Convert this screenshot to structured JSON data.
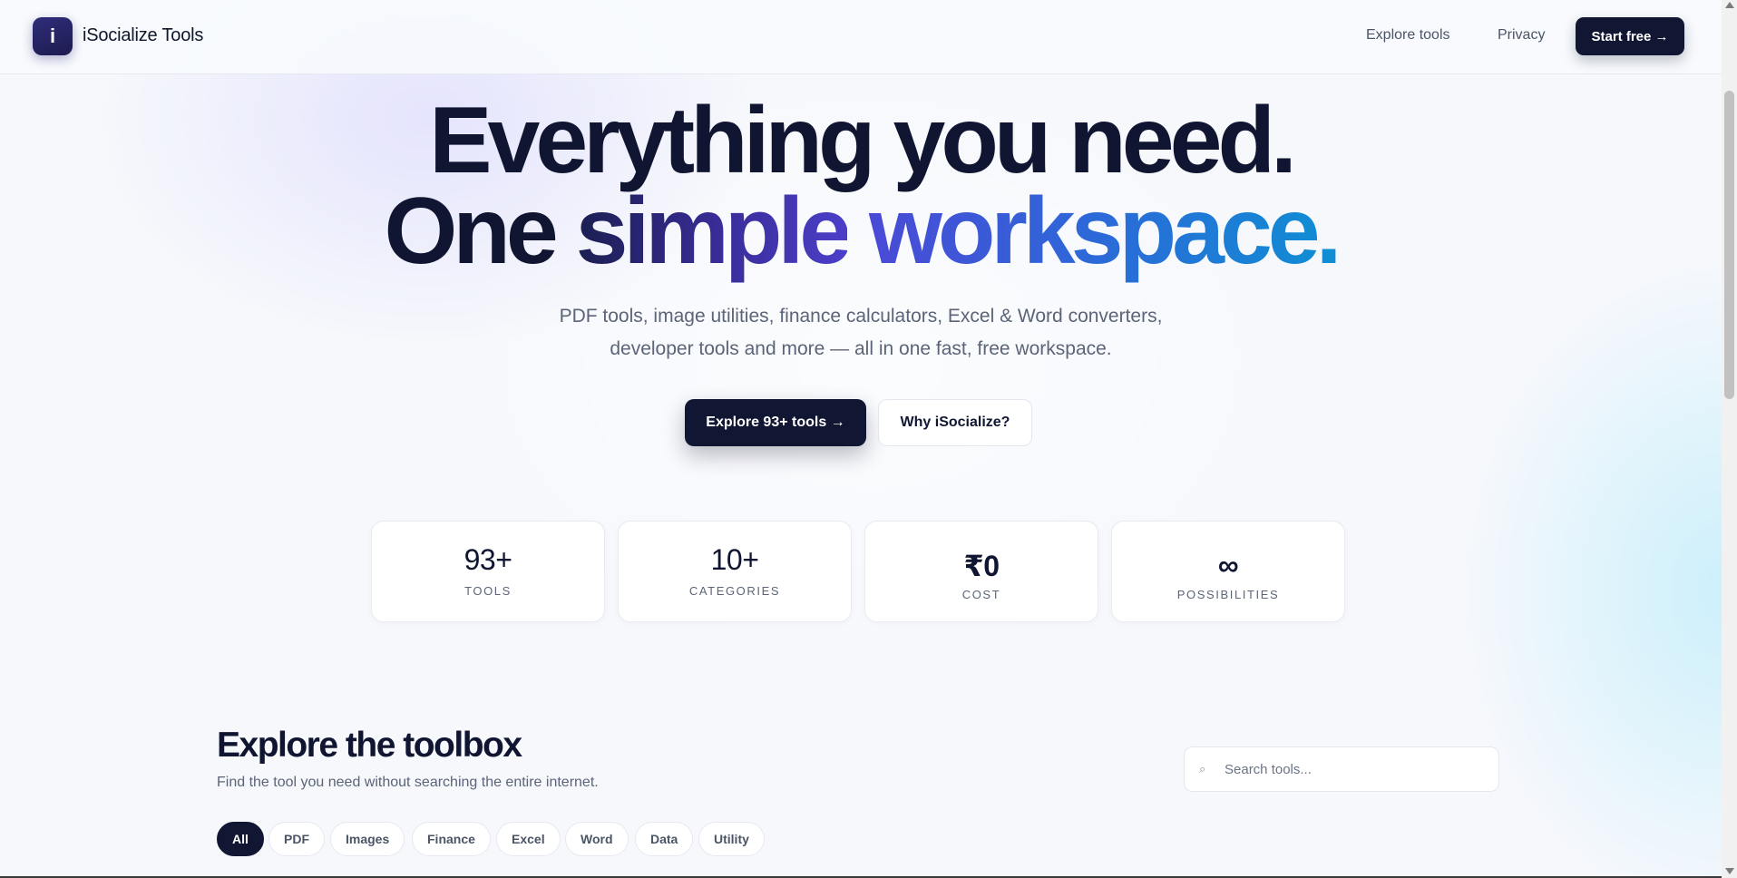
{
  "nav": {
    "logo_letter": "i",
    "brand": "iSocialize Tools",
    "explore_label": "Explore tools",
    "privacy_label": "Privacy",
    "cta_label": "Start free →"
  },
  "hero": {
    "line1": "Everything you need.",
    "line2_part1": "One ",
    "line2_part2": "simple",
    "line2_part3": " ",
    "line2_part4": "workspace.",
    "subtitle_line1": "PDF tools, image utilities, finance calculators, Excel & Word converters,",
    "subtitle_line2": "developer tools and more — all in one fast, free workspace.",
    "primary_button": "Explore 93+ tools →",
    "secondary_button": "Why iSocialize?"
  },
  "stats": [
    {
      "value": "93+",
      "label": "TOOLS"
    },
    {
      "value": "10+",
      "label": "CATEGORIES"
    },
    {
      "value": "₹0",
      "label": "COST"
    },
    {
      "value": "∞",
      "label": "POSSIBILITIES"
    }
  ],
  "toolbox": {
    "title": "Explore the toolbox",
    "subtitle": "Find the tool you need without searching the entire internet.",
    "search_placeholder": "Search tools...",
    "search_icon": "⌕",
    "filters": [
      "All",
      "PDF",
      "Images",
      "Finance",
      "Excel",
      "Word",
      "Data",
      "Utility"
    ],
    "active_filter": "All"
  },
  "colors": {
    "primary": "#111633",
    "gradient_start": "#3a2d9a",
    "gradient_end": "#0f8fd3",
    "text_muted": "#5b6478"
  }
}
